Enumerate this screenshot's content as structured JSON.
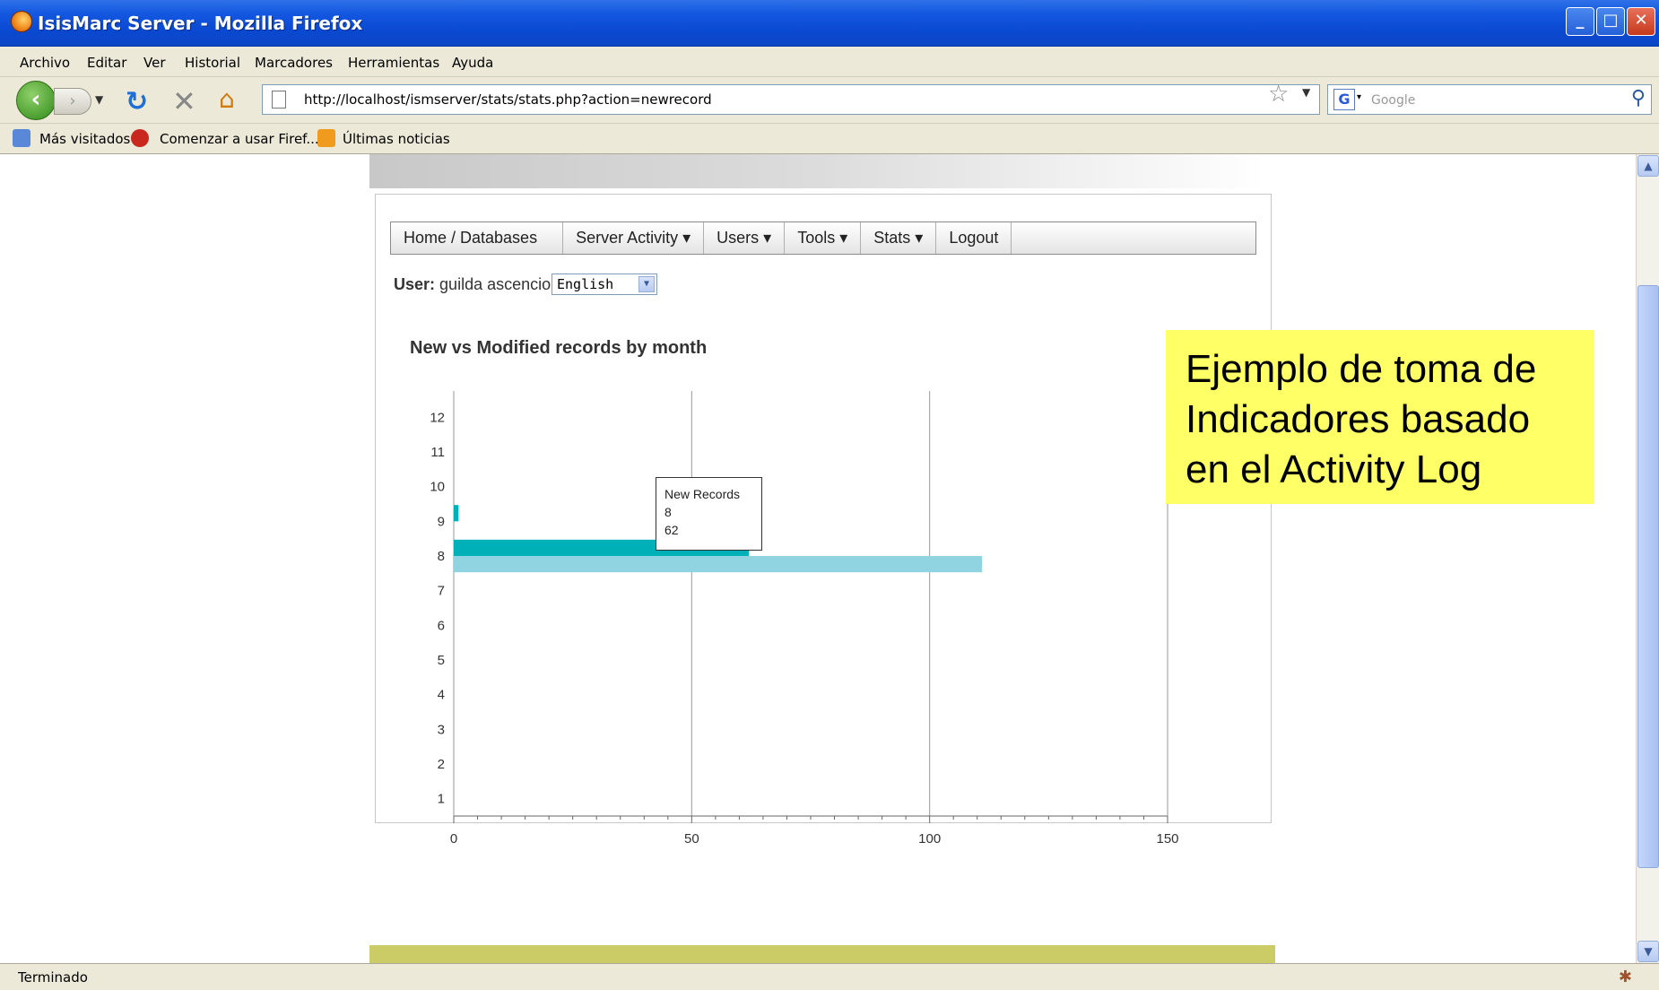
{
  "window": {
    "title": "IsisMarc Server - Mozilla Firefox"
  },
  "menubar": [
    "Archivo",
    "Editar",
    "Ver",
    "Historial",
    "Marcadores",
    "Herramientas",
    "Ayuda"
  ],
  "navigation": {
    "url": "http://localhost/ismserver/stats/stats.php?action=newrecord",
    "search_placeholder": "Google"
  },
  "bookmarks": [
    "Más visitados",
    "Comenzar a usar Firef...",
    "Últimas noticias"
  ],
  "page": {
    "nav": [
      "Home / Databases",
      "Server Activity ▾",
      "Users ▾",
      "Tools ▾",
      "Stats ▾",
      "Logout"
    ],
    "user_label": "User:",
    "user_name": "guilda ascencio",
    "language": "English",
    "chart_title": "New vs Modified records by month"
  },
  "chart_data": {
    "type": "bar",
    "orientation": "horizontal",
    "title": "New vs Modified records by month",
    "categories": [
      "1",
      "2",
      "3",
      "4",
      "5",
      "6",
      "7",
      "8",
      "9",
      "10",
      "11",
      "12"
    ],
    "series": [
      {
        "name": "New Records",
        "color": "#00b0b8",
        "values": [
          0,
          0,
          0,
          0,
          0,
          0,
          0,
          62,
          1,
          0,
          0,
          0
        ]
      },
      {
        "name": "",
        "color": "#8fd4e0",
        "values": [
          0,
          0,
          0,
          0,
          0,
          0,
          0,
          111,
          0,
          0,
          0,
          0
        ]
      }
    ],
    "xlim": [
      0,
      150
    ],
    "xticks": [
      0,
      50,
      100,
      150
    ],
    "grid": true,
    "tooltip": {
      "series": "New Records",
      "category": "8",
      "value": "62"
    }
  },
  "callout": {
    "lines": [
      "Ejemplo de toma de",
      "Indicadores basado",
      "en el Activity Log"
    ],
    "background": "#ffff66"
  },
  "status": "Terminado"
}
